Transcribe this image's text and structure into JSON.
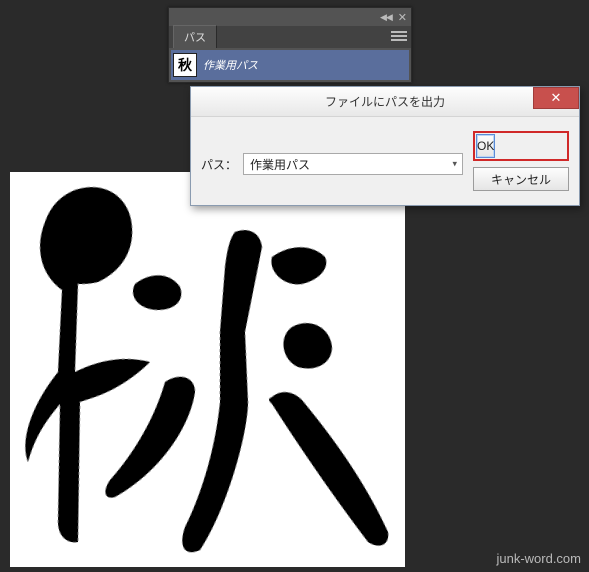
{
  "panel": {
    "tab_label": "パス",
    "item": {
      "thumb_char": "秋",
      "name": "作業用パス"
    }
  },
  "dialog": {
    "title": "ファイルにパスを出力",
    "field_label": "パス：",
    "select_value": "作業用パス",
    "ok_label": "OK",
    "cancel_label": "キャンセル"
  },
  "watermark": "junk-word.com"
}
